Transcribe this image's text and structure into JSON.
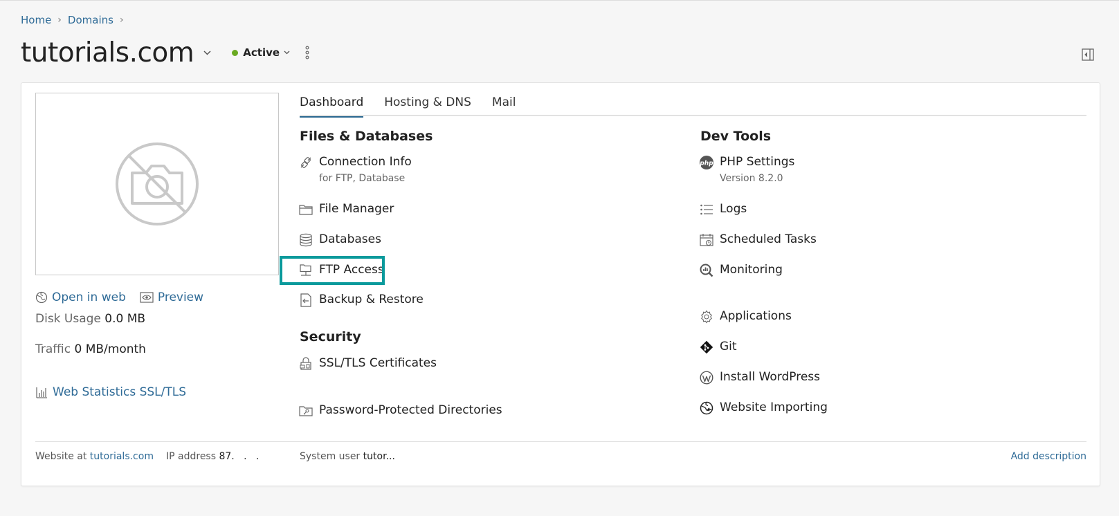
{
  "breadcrumb": {
    "home": "Home",
    "domains": "Domains"
  },
  "header": {
    "title": "tutorials.com",
    "status": "Active"
  },
  "sidebar": {
    "open_in_web": "Open in web",
    "preview": "Preview",
    "disk_usage_label": "Disk Usage",
    "disk_usage_value": "0.0 MB",
    "traffic_label": "Traffic",
    "traffic_value": "0 MB/month",
    "web_statistics": "Web Statistics SSL/TLS"
  },
  "tabs": [
    {
      "label": "Dashboard",
      "active": true
    },
    {
      "label": "Hosting & DNS",
      "active": false
    },
    {
      "label": "Mail",
      "active": false
    }
  ],
  "files_databases": {
    "title": "Files & Databases",
    "items": [
      {
        "label": "Connection Info",
        "sub": "for FTP, Database",
        "icon": "connection-icon"
      },
      {
        "label": "File Manager",
        "icon": "folder-icon"
      },
      {
        "label": "Databases",
        "icon": "database-icon"
      },
      {
        "label": "FTP Access",
        "icon": "ftp-icon"
      },
      {
        "label": "Backup & Restore",
        "icon": "backup-icon"
      }
    ]
  },
  "security": {
    "title": "Security",
    "items": [
      {
        "label": "SSL/TLS Certificates",
        "icon": "certificate-icon"
      },
      {
        "label": "Password-Protected Directories",
        "icon": "protected-folder-icon"
      }
    ]
  },
  "dev_tools": {
    "title": "Dev Tools",
    "items": [
      {
        "label": "PHP Settings",
        "sub": "Version 8.2.0",
        "icon": "php-icon"
      },
      {
        "label": "Logs",
        "icon": "logs-icon"
      },
      {
        "label": "Scheduled Tasks",
        "icon": "calendar-icon"
      },
      {
        "label": "Monitoring",
        "icon": "monitoring-icon"
      },
      {
        "label": "Applications",
        "icon": "gear-icon"
      },
      {
        "label": "Git",
        "icon": "git-icon"
      },
      {
        "label": "Install WordPress",
        "icon": "wordpress-icon"
      },
      {
        "label": "Website Importing",
        "icon": "import-icon"
      }
    ]
  },
  "footer": {
    "website_label": "Website at",
    "website_value": "tutorials.com",
    "ip_label": "IP address",
    "ip_value": "87.   .   .",
    "sysuser_label": "System user",
    "sysuser_value": "tutor...",
    "add_description": "Add description"
  },
  "colors": {
    "link": "#2f6b97",
    "status_active": "#6aaa22",
    "highlight": "#0a9a9c",
    "tab_active": "#28678f"
  }
}
